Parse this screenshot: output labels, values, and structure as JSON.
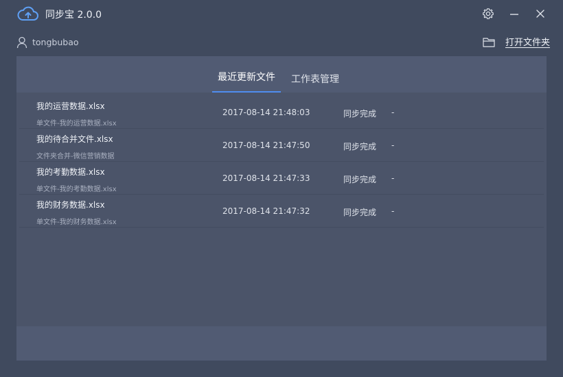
{
  "window": {
    "title": "同步宝 2.0.0",
    "icons": [
      "cloud-upload-icon",
      "gear-icon",
      "minimize-icon",
      "close-icon"
    ]
  },
  "user": {
    "name": "tongbubao",
    "open_folder_label": "打开文件夹"
  },
  "tabs": [
    {
      "label": "最近更新文件",
      "active": true
    },
    {
      "label": "工作表管理",
      "active": false
    }
  ],
  "files": [
    {
      "name": "我的运营数据.xlsx",
      "sub": "单文件-我的运营数据.xlsx",
      "time": "2017-08-14 21:48:03",
      "status": "同步完成",
      "extra": "-"
    },
    {
      "name": "我的待合并文件.xlsx",
      "sub": "文件夹合并-微信营销数据",
      "time": "2017-08-14 21:47:50",
      "status": "同步完成",
      "extra": "-"
    },
    {
      "name": "我的考勤数据.xlsx",
      "sub": "单文件-我的考勤数据.xlsx",
      "time": "2017-08-14 21:47:33",
      "status": "同步完成",
      "extra": "-"
    },
    {
      "name": "我的财务数据.xlsx",
      "sub": "单文件-我的财务数据.xlsx",
      "time": "2017-08-14 21:47:32",
      "status": "同步完成",
      "extra": "-"
    }
  ],
  "colors": {
    "background": "#404a5e",
    "panel": "#4b5469",
    "tab_bar": "#515b73",
    "accent": "#4f8ef0"
  }
}
